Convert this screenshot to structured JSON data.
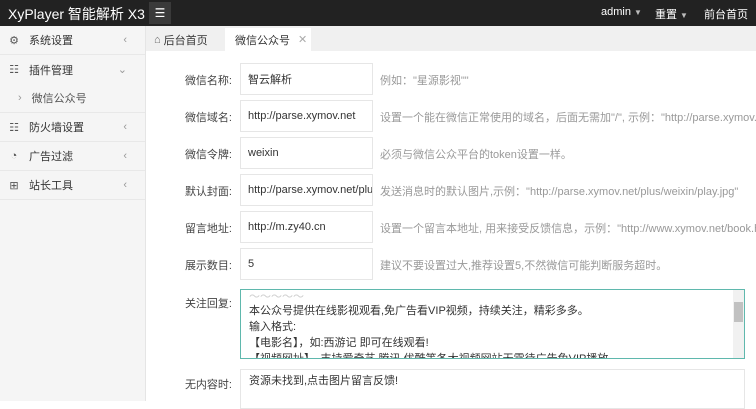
{
  "header": {
    "title": "XyPlayer 智能解析 X3",
    "user": "admin",
    "reset": "重置",
    "frontend": "前台首页"
  },
  "sidebar": {
    "items": [
      {
        "label": "系统设置",
        "icon": "gear-icon"
      },
      {
        "label": "插件管理",
        "icon": "list-icon"
      },
      {
        "label": "微信公众号",
        "sub": true
      },
      {
        "label": "防火墙设置",
        "icon": "list-icon"
      },
      {
        "label": "广告过滤",
        "icon": "chart-icon"
      },
      {
        "label": "站长工具",
        "icon": "grid-icon"
      }
    ]
  },
  "tabs": [
    {
      "label": "后台首页"
    },
    {
      "label": "微信公众号"
    }
  ],
  "form": [
    {
      "label": "微信名称:",
      "value": "智云解析",
      "hint": "例如：\"星源影视\"\""
    },
    {
      "label": "微信域名:",
      "value": "http://parse.xymov.net",
      "hint": "设置一个能在微信正常使用的域名，后面无需加\"/\", 示例：\"http://parse.xymov.net\""
    },
    {
      "label": "微信令牌:",
      "value": "weixin",
      "hint": "必须与微信公众平台的token设置一样。"
    },
    {
      "label": "默认封面:",
      "value": "http://parse.xymov.net/plus/weixin/play.jpg",
      "hint": "发送消息时的默认图片,示例：\"http://parse.xymov.net/plus/weixin/play.jpg\""
    },
    {
      "label": "留言地址:",
      "value": "http://m.zy40.cn",
      "hint": "设置一个留言本地址, 用来接受反馈信息，示例：\"http://www.xymov.net/book.htm\""
    },
    {
      "label": "展示数目:",
      "value": "5",
      "hint": "建议不要设置过大,推荐设置5,不然微信可能判断服务超时。"
    }
  ],
  "follow": {
    "label": "关注回复:",
    "lines": [
      "本公众号提供在线影视观看,免广告看VIP视频，持续关注，精彩多多。",
      "输入格式:",
      "【电影名】，如:西游记 即可在线观看!",
      "【视频网址】，支持爱奇艺,腾讯,优酷等各大视频网站无需待广告免VIP播放"
    ]
  },
  "nocontent": {
    "label": "无内容时:",
    "value": "资源未找到,点击图片留言反馈!"
  }
}
